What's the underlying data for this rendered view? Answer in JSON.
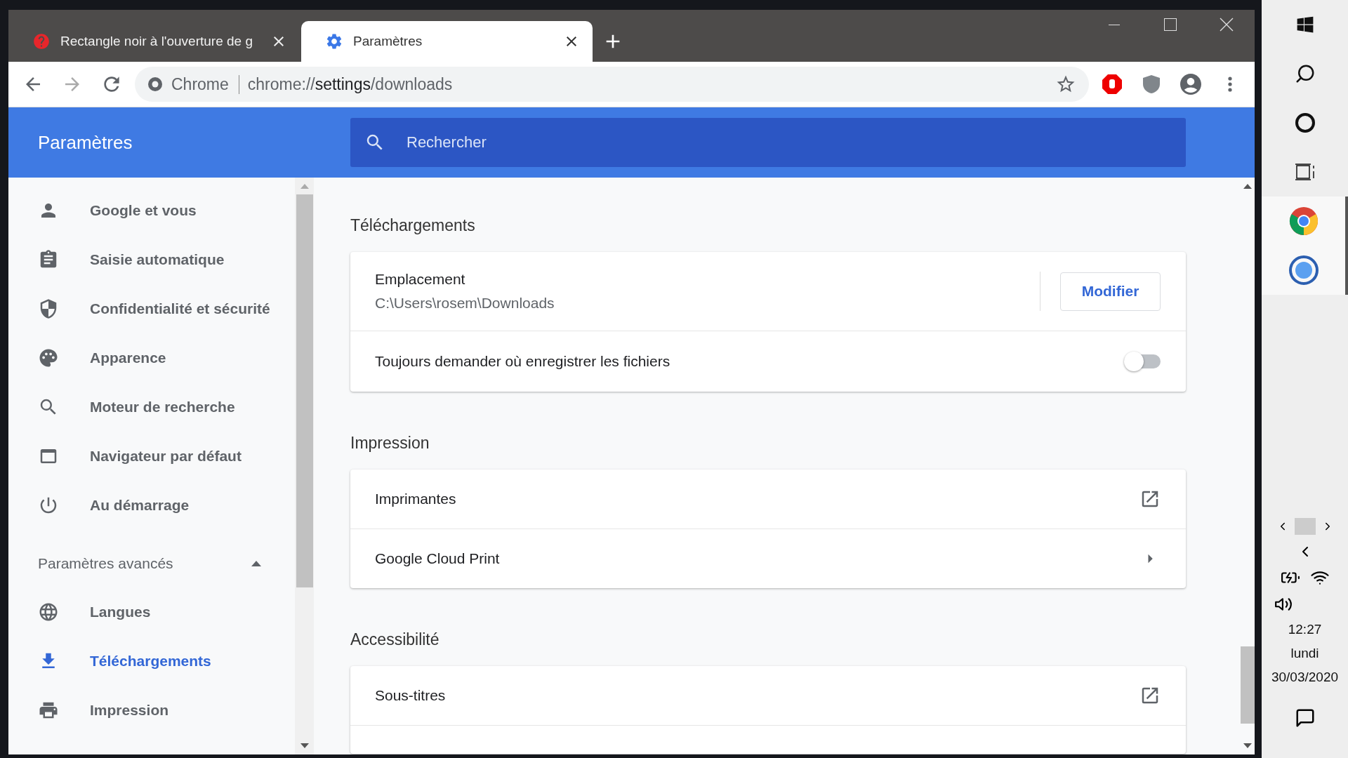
{
  "tabs": [
    {
      "kind": "help",
      "title": "Rectangle noir à l'ouverture de g",
      "selected": false
    },
    {
      "kind": "settings",
      "title": "Paramètres",
      "selected": true
    }
  ],
  "address_bar": {
    "site": "Chrome",
    "url_pre": "chrome://",
    "url_host": "settings",
    "url_post": "/downloads"
  },
  "header": {
    "title": "Paramètres",
    "search_placeholder": "Rechercher"
  },
  "sidebar": {
    "items": [
      {
        "label": "Google et vous",
        "selected": false
      },
      {
        "label": "Saisie automatique",
        "selected": false
      },
      {
        "label": "Confidentialité et sécurité",
        "selected": false
      },
      {
        "label": "Apparence",
        "selected": false
      },
      {
        "label": "Moteur de recherche",
        "selected": false
      },
      {
        "label": "Navigateur par défaut",
        "selected": false
      },
      {
        "label": "Au démarrage",
        "selected": false
      }
    ],
    "advanced": {
      "label": "Paramètres avancés",
      "expanded": true,
      "items": [
        {
          "label": "Langues",
          "selected": false
        },
        {
          "label": "Téléchargements",
          "selected": true
        },
        {
          "label": "Impression",
          "selected": false
        }
      ]
    }
  },
  "sections": [
    {
      "title": "Téléchargements",
      "rows": [
        {
          "kind": "location",
          "label": "Emplacement",
          "value": "C:\\Users\\rosem\\Downloads",
          "button": "Modifier"
        },
        {
          "kind": "toggle",
          "label": "Toujours demander où enregistrer les fichiers",
          "on": false
        }
      ]
    },
    {
      "title": "Impression",
      "rows": [
        {
          "kind": "external",
          "label": "Imprimantes"
        },
        {
          "kind": "arrow",
          "label": "Google Cloud Print"
        }
      ]
    },
    {
      "title": "Accessibilité",
      "rows": [
        {
          "kind": "external",
          "label": "Sous-titres"
        }
      ]
    }
  ],
  "taskbar": {
    "time": "12:27",
    "day": "lundi",
    "date": "30/03/2020"
  }
}
